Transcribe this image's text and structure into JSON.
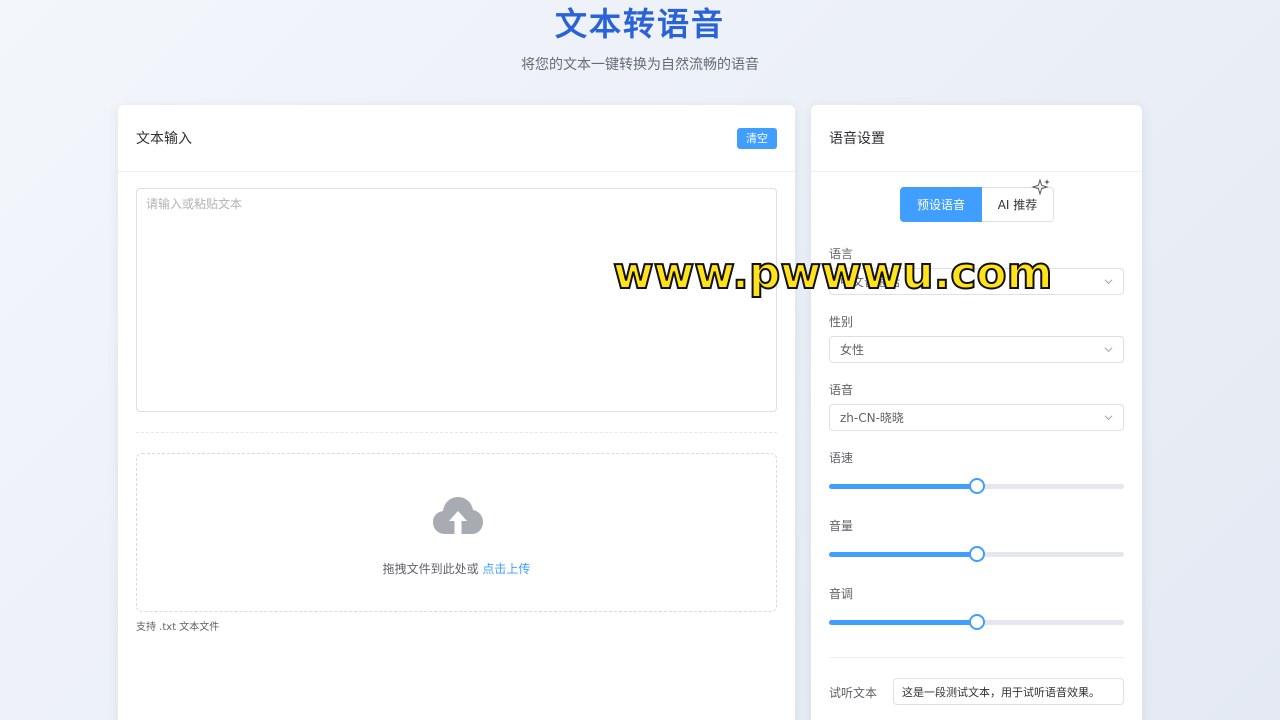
{
  "header": {
    "title": "文本转语音",
    "subtitle": "将您的文本一键转换为自然流畅的语音"
  },
  "text_panel": {
    "title": "文本输入",
    "clear_label": "清空",
    "textarea_value": "",
    "textarea_placeholder": "请输入或粘贴文本",
    "upload_text": "拖拽文件到此处或",
    "upload_link": "点击上传",
    "upload_tip": "支持 .txt 文本文件",
    "upload_icon": "cloud-upload-icon"
  },
  "settings_panel": {
    "title": "语音设置",
    "tabs": [
      {
        "label": "预设语音",
        "active": true
      },
      {
        "label": "AI 推荐",
        "active": false,
        "icon": "sparkle-icon"
      }
    ],
    "language": {
      "label": "语言",
      "value": "中文普通话"
    },
    "gender": {
      "label": "性别",
      "value": "女性"
    },
    "voice": {
      "label": "语音",
      "value": "zh-CN-晓晓"
    },
    "rate": {
      "label": "语速",
      "level": 0.5
    },
    "volume": {
      "label": "音量",
      "level": 0.5
    },
    "pitch": {
      "label": "音调",
      "level": 0.5
    },
    "preview": {
      "label": "试听文本",
      "value": "这是一段测试文本，用于试听语音效果。"
    }
  },
  "watermark": "www.pwwwu.com",
  "colors": {
    "accent": "#409eff",
    "title": "#2a62d8",
    "watermark_fill": "#ffe21a"
  }
}
